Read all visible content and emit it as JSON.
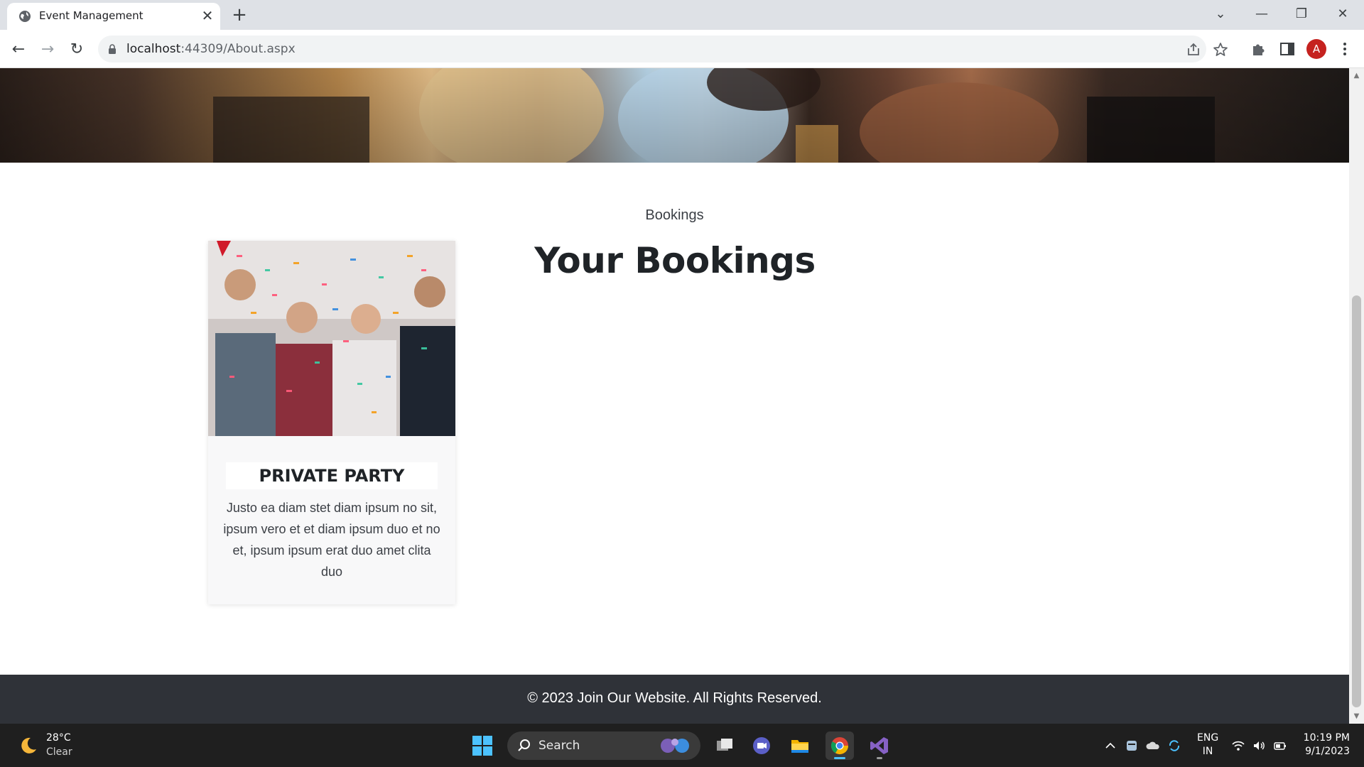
{
  "browser": {
    "tab_title": "Event Management",
    "url_host": "localhost",
    "url_rest": ":44309/About.aspx",
    "avatar_letter": "A"
  },
  "page": {
    "section_label": "Bookings",
    "section_title": "Your Bookings",
    "cards": [
      {
        "title": "PRIVATE PARTY",
        "text": "Justo ea diam stet diam ipsum no sit, ipsum vero et et diam ipsum duo et no et, ipsum ipsum erat duo amet clita duo"
      }
    ],
    "footer_text": "© 2023 Join Our Website. All Rights Reserved."
  },
  "taskbar": {
    "weather_temp": "28°C",
    "weather_desc": "Clear",
    "search_label": "Search",
    "lang_line1": "ENG",
    "lang_line2": "IN",
    "time": "10:19 PM",
    "date": "9/1/2023"
  },
  "colors": {
    "footer_bg": "#2f3238",
    "card_bg": "#f8f8f9",
    "taskbar_bg": "#1f1f1f",
    "avatar_bg": "#c5221f"
  }
}
